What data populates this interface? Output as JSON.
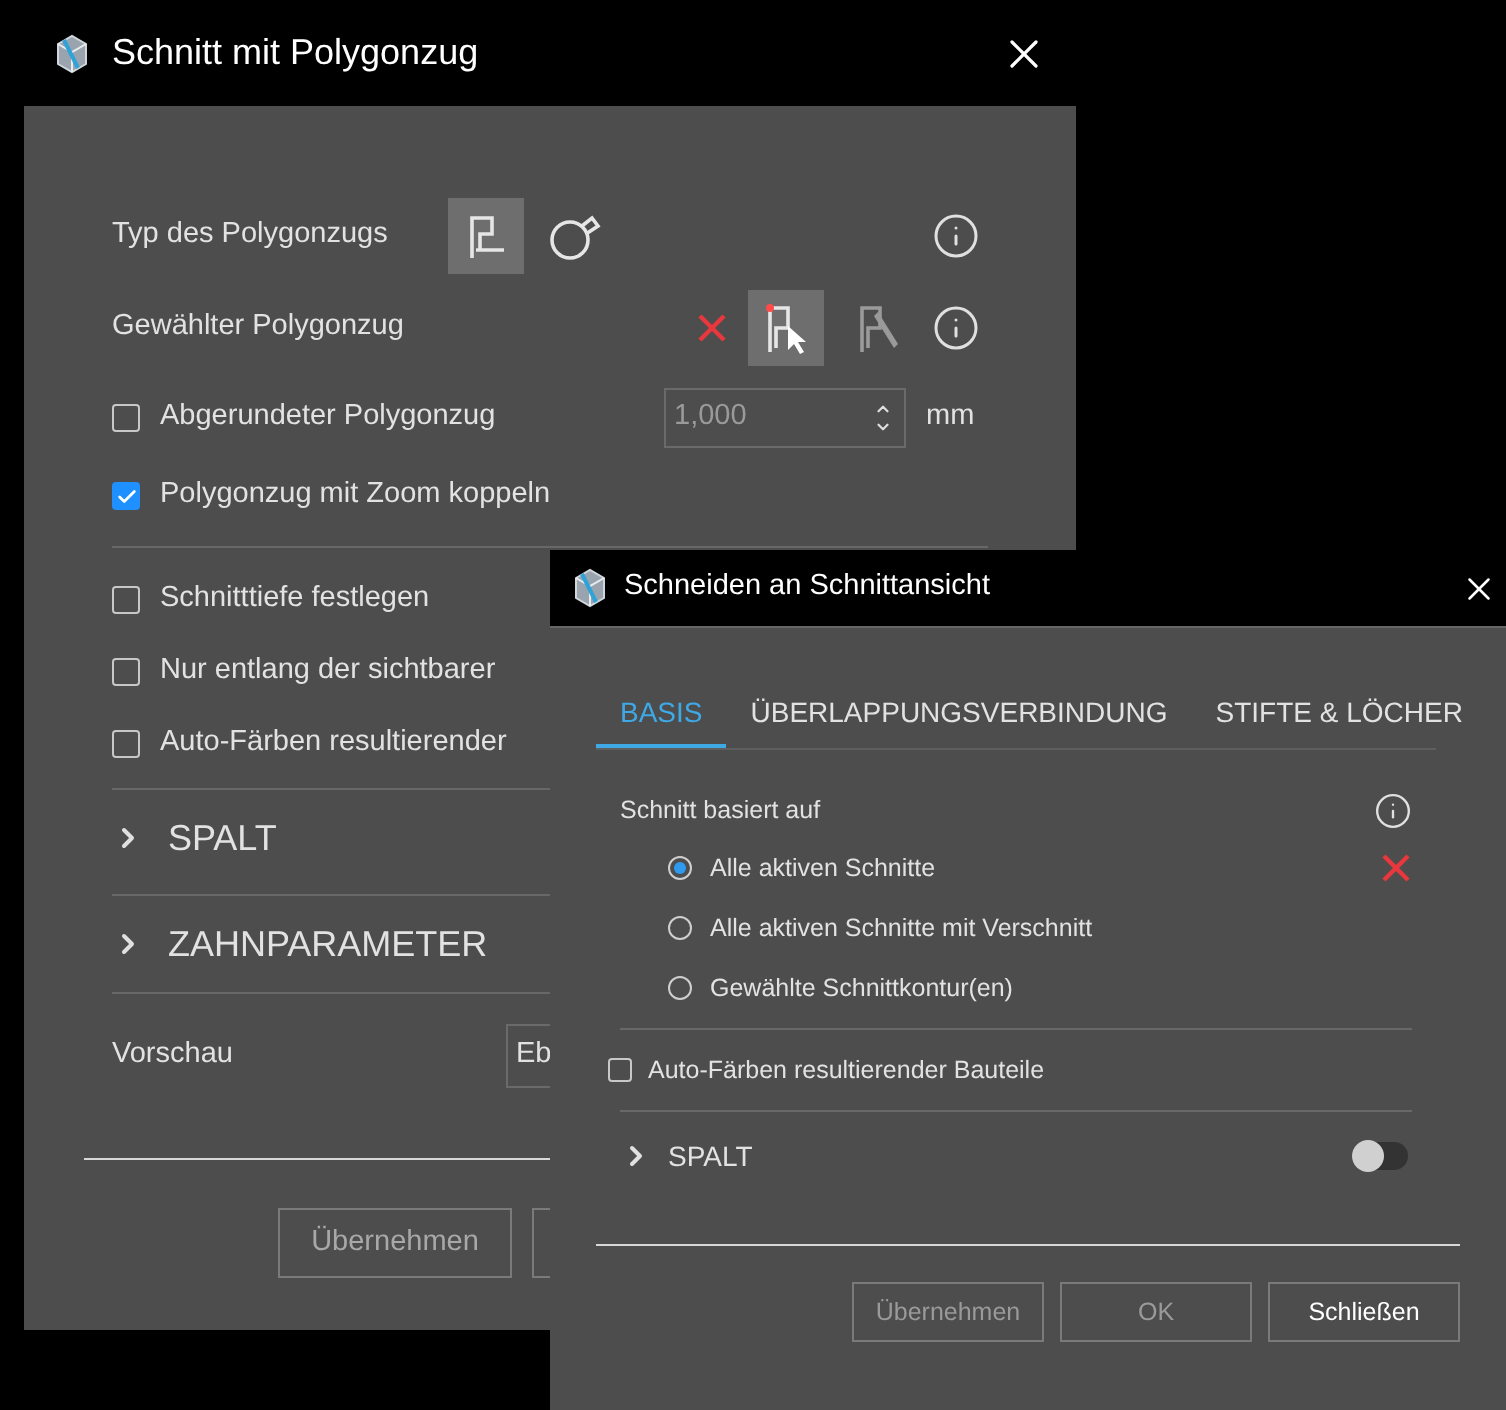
{
  "main_dialog": {
    "title": "Schnitt mit Polygonzug",
    "polygon_type": {
      "label": "Typ des Polygonzugs",
      "options": [
        {
          "kind": "polyline",
          "selected": true
        },
        {
          "kind": "lasso",
          "selected": false
        }
      ]
    },
    "selected_polygon": {
      "label": "Gewählter Polygonzug",
      "tools": [
        {
          "kind": "pick",
          "selected": true
        },
        {
          "kind": "draw",
          "selected": false
        }
      ]
    },
    "rounded": {
      "label": "Abgerundeter Polygonzug",
      "checked": false,
      "value": "1,000",
      "unit": "mm"
    },
    "zoom_link": {
      "label": "Polygonzug mit Zoom koppeln",
      "checked": true
    },
    "checkboxes": [
      {
        "label": "Schnitttiefe festlegen",
        "checked": false
      },
      {
        "label": "Nur entlang der sichtbarer",
        "checked": false
      },
      {
        "label": "Auto-Färben resultierender",
        "checked": false
      }
    ],
    "sections": [
      {
        "label": "SPALT",
        "expanded": false
      },
      {
        "label": "ZAHNPARAMETER",
        "expanded": false
      }
    ],
    "preview": {
      "label": "Vorschau",
      "value": "Eb"
    },
    "buttons": [
      "Übernehmen"
    ]
  },
  "overlay_dialog": {
    "title": "Schneiden an Schnittansicht",
    "tabs": [
      {
        "label": "BASIS",
        "selected": true
      },
      {
        "label": "ÜBERLAPPUNGSVERBINDUNG",
        "selected": false
      },
      {
        "label": "STIFTE & LÖCHER",
        "selected": false
      }
    ],
    "cut_basis": {
      "label": "Schnitt basiert auf",
      "options": [
        {
          "label": "Alle aktiven Schnitte",
          "selected": true
        },
        {
          "label": "Alle aktiven Schnitte mit Verschnitt",
          "selected": false
        },
        {
          "label": "Gewählte Schnittkontur(en)",
          "selected": false
        }
      ]
    },
    "auto_color": {
      "label": "Auto-Färben resultierender Bauteile",
      "checked": false
    },
    "section": {
      "label": "SPALT",
      "expanded": false,
      "on": false
    },
    "buttons": [
      {
        "label": "Übernehmen",
        "disabled": true
      },
      {
        "label": "OK",
        "disabled": true
      },
      {
        "label": "Schließen",
        "disabled": false
      }
    ]
  }
}
